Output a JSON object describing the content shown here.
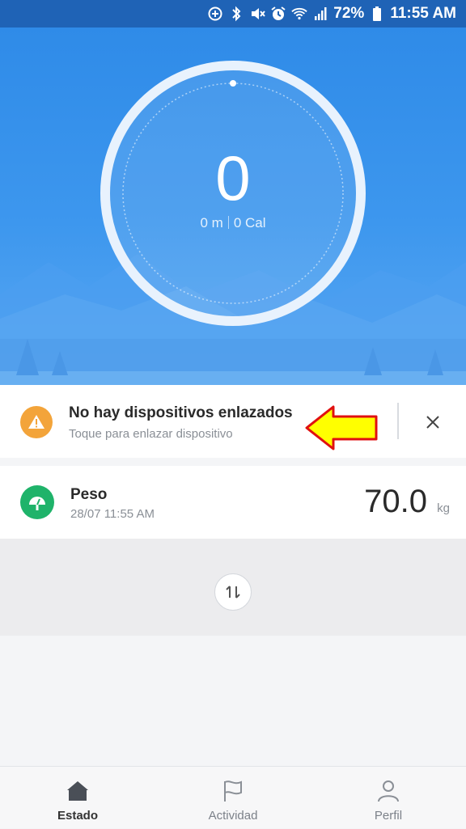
{
  "status_bar": {
    "battery_percent": "72%",
    "time": "11:55 AM",
    "icons": [
      "data-saver-icon",
      "bluetooth-icon",
      "mute-icon",
      "alarm-icon",
      "wifi-icon",
      "signal-icon",
      "battery-icon"
    ]
  },
  "activity": {
    "steps": "0",
    "distance": "0 m",
    "calories": "0 Cal"
  },
  "device_banner": {
    "title": "No hay dispositivos enlazados",
    "subtitle": "Toque para enlazar dispositivo",
    "icon": "warning-icon",
    "icon_color": "#f3a43a"
  },
  "weight": {
    "label": "Peso",
    "timestamp": "28/07 11:55 AM",
    "value": "70.0",
    "unit": "kg",
    "icon": "scale-icon",
    "icon_color": "#1fb36a"
  },
  "nav": {
    "items": [
      {
        "label": "Estado",
        "icon": "home-icon",
        "active": true
      },
      {
        "label": "Actividad",
        "icon": "flag-icon",
        "active": false
      },
      {
        "label": "Perfil",
        "icon": "person-icon",
        "active": false
      }
    ]
  },
  "colors": {
    "status_bar": "#1f63b6",
    "hero": "#3d97ee",
    "annotation_arrow": "#ffff00"
  }
}
